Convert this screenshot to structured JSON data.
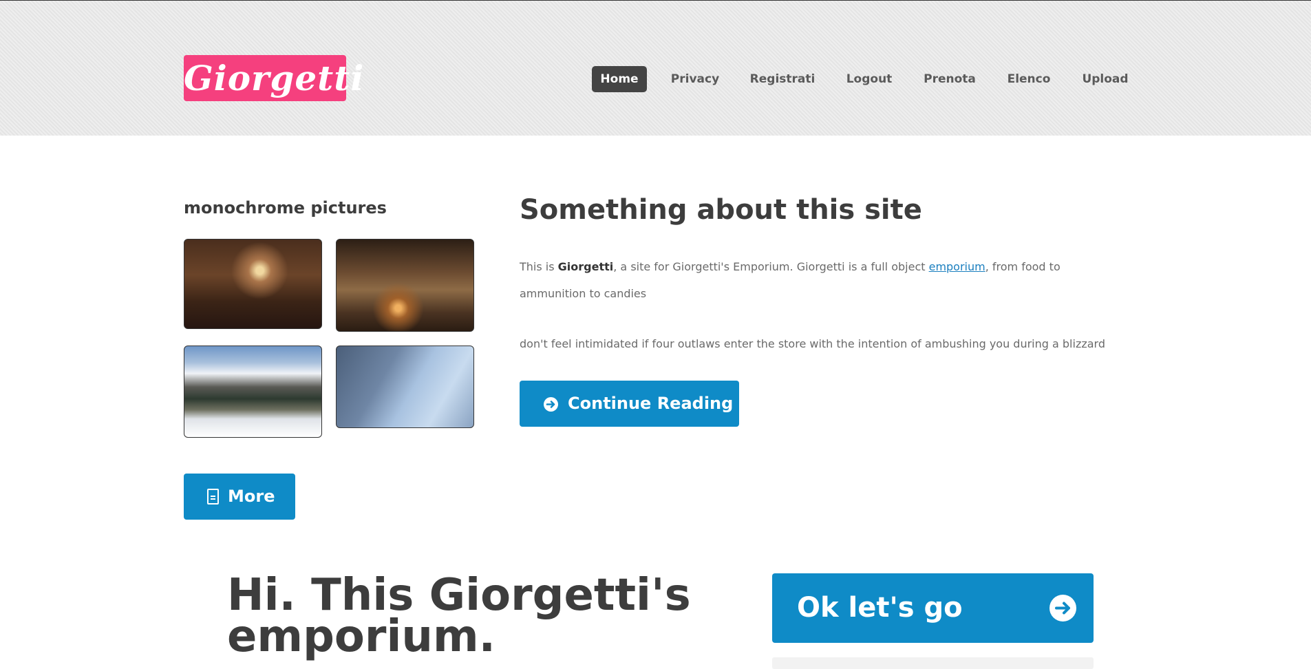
{
  "header": {
    "logo_text": "Giorgetti",
    "nav": [
      {
        "label": "Home",
        "active": true
      },
      {
        "label": "Privacy",
        "active": false
      },
      {
        "label": "Registrati",
        "active": false
      },
      {
        "label": "Logout",
        "active": false
      },
      {
        "label": "Prenota",
        "active": false
      },
      {
        "label": "Elenco",
        "active": false
      },
      {
        "label": "Upload",
        "active": false
      }
    ]
  },
  "sidebar": {
    "title": "monochrome pictures",
    "more_label": "More"
  },
  "main": {
    "title": "Something about this site",
    "para1_prefix": "This is ",
    "para1_bold": "Giorgetti",
    "para1_middle": ", a site for Giorgetti's Emporium. Giorgetti is a full object ",
    "para1_link": "emporium",
    "para1_suffix": ", from food to ammunition to candies",
    "para2": "don't feel intimidated if four outlaws enter the store with the intention of ambushing you during a blizzard",
    "continue_label": "Continue Reading"
  },
  "hero": {
    "title": "Hi. This Giorgetti's emporium.",
    "go_label": "Ok let's go"
  },
  "colors": {
    "accent": "#0f8bc7",
    "logo": "#f5407e",
    "nav_active": "#444444"
  }
}
